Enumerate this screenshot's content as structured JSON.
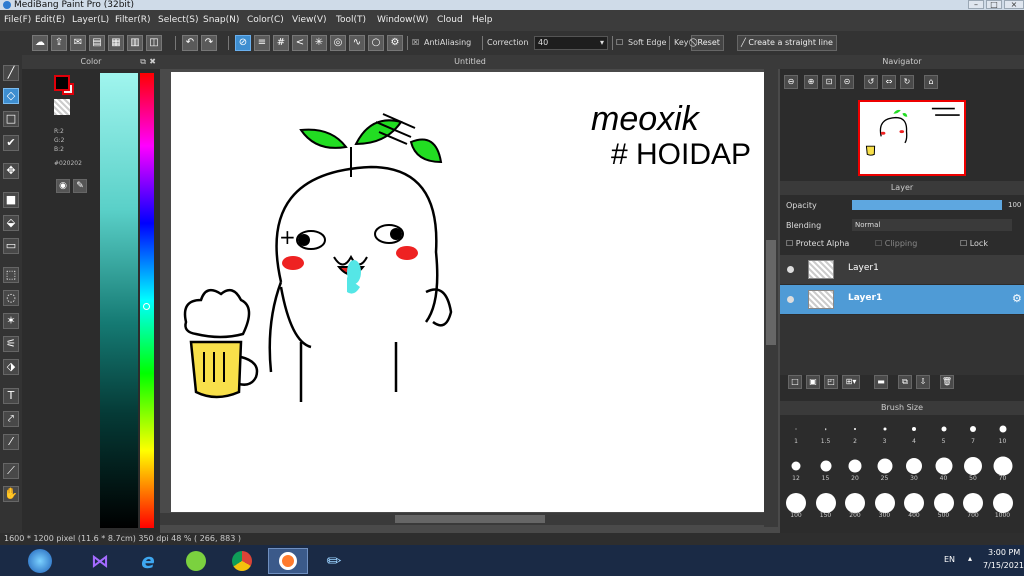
{
  "window": {
    "title": "MediBang Paint Pro (32bit)"
  },
  "menu": [
    "File(F)",
    "Edit(E)",
    "Layer(L)",
    "Filter(R)",
    "Select(S)",
    "Snap(N)",
    "Color(C)",
    "View(V)",
    "Tool(T)",
    "Window(W)",
    "Cloud",
    "Help"
  ],
  "toolbar": {
    "antialiasing_label": "AntiAliasing",
    "correction_label": "Correction",
    "correction_value": "40",
    "soft_edge_label": "Soft Edge",
    "key_label": "Key",
    "reset_label": "Reset",
    "straight_line_label": "Create a straight line"
  },
  "color_panel": {
    "title": "Color",
    "r": "R:2",
    "g": "G:2",
    "b": "B:2",
    "hex": "#020202",
    "foreground_color": "#020202",
    "background_color": "#f2f2f2",
    "frame_color": "#e0000a"
  },
  "document": {
    "tab_title": "Untitled"
  },
  "canvas": {
    "text_line1": "meoxik",
    "text_line2": "# HOIDAP"
  },
  "navigator": {
    "title": "Navigator"
  },
  "layer_panel": {
    "title": "Layer",
    "opacity_label": "Opacity",
    "opacity_value": "100",
    "blending_label": "Blending",
    "blending_value": "Normal",
    "protect_alpha_label": "Protect Alpha",
    "clipping_label": "Clipping",
    "lock_label": "Lock",
    "layers": [
      {
        "name": "Layer1",
        "selected": false
      },
      {
        "name": "Layer1",
        "selected": true
      }
    ]
  },
  "brush_panel": {
    "title": "Brush Size",
    "sizes": [
      "1",
      "1.5",
      "2",
      "3",
      "4",
      "5",
      "7",
      "10",
      "12",
      "15",
      "20",
      "25",
      "30",
      "40",
      "50",
      "70",
      "100",
      "150",
      "200",
      "300",
      "400",
      "500",
      "700",
      "1000"
    ]
  },
  "status": {
    "text": "1600 * 1200 pixel  (11.6 * 8.7cm)  350 dpi  48 %  ( 266, 883 )"
  },
  "taskbar": {
    "language": "EN",
    "time": "3:00 PM",
    "date": "7/15/2021"
  }
}
